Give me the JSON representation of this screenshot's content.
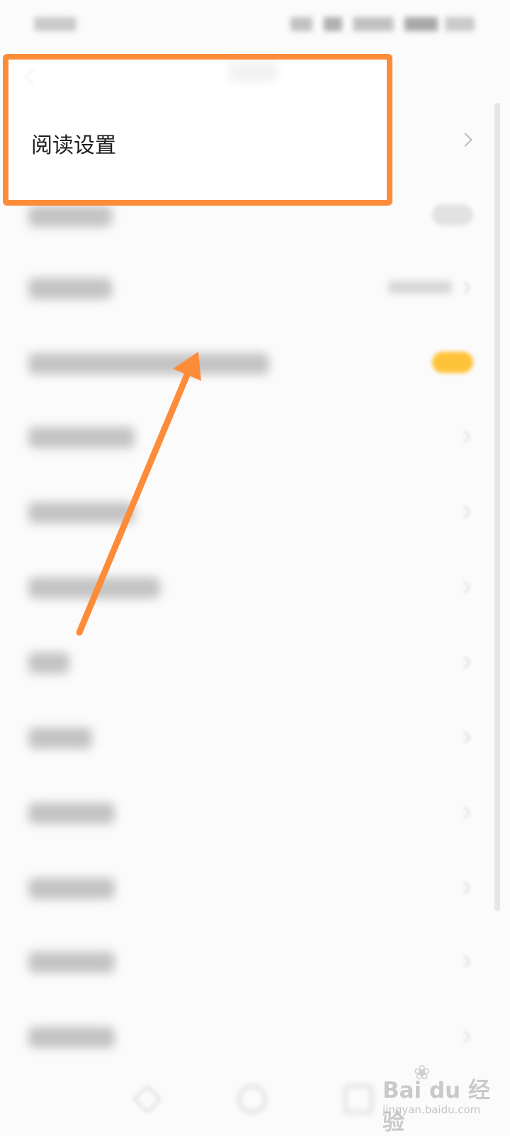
{
  "highlight": {
    "label": "阅读设置",
    "outline_color": "#fd8c3a"
  },
  "icons": {
    "chevron": "chevron-right-icon",
    "back": "back-arrow-icon",
    "arrow": "annotation-arrow"
  },
  "watermark": {
    "main": "Bai du 经验",
    "sub": "jingyan.baidu.com"
  },
  "toggle_on_color": "#ffc33a"
}
